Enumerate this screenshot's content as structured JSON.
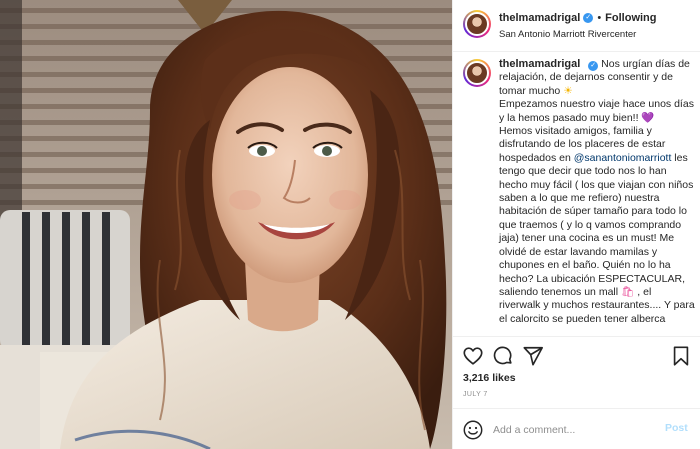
{
  "post": {
    "author": {
      "username": "thelmamadrigal",
      "verified": true,
      "follow_state": "Following",
      "location": "San Antonio Marriott Rivercenter"
    },
    "caption": {
      "p1": "Nos urgían días de relajación, de dejarnos consentir y de tomar mucho",
      "emoji_sun": "☀",
      "p2": "Empezamos nuestro viaje hace unos días y la hemos pasado muy bien!!",
      "emoji_heart": "💜",
      "p3": "Hemos visitado amigos, familia y disfrutando de los placeres de estar hospedados en",
      "mention": "@sanantoniomarriott",
      "p4": "les tengo que decir que todo nos lo han hecho muy fácil ( los que viajan con niños saben a lo que me refiero) nuestra habitación de súper tamaño para todo lo que traemos ( y lo q vamos comprando jaja) tener una cocina es un must! Me olvidé de estar lavando mamilas y chupones en el baño. Quién no lo ha hecho? La ubicación ESPECTACULAR, saliendo tenemos un mall",
      "emoji_bag": "🛍",
      "p5": ", el riverwalk y muchos restaurantes.... Y para el calorcito se",
      "p6": "pueden tener alberca"
    },
    "likes": "3,216 likes",
    "date": "JULY 7"
  },
  "icons": {
    "like": "heart-outline-icon",
    "comment": "speech-bubble-icon",
    "share": "paper-plane-icon",
    "save": "bookmark-icon",
    "emoji": "smile-face-icon",
    "verified": "verified-badge-icon"
  },
  "comment_box": {
    "placeholder": "Add a comment...",
    "post_label": "Post"
  },
  "colors": {
    "verified": "#3897f0",
    "mention": "#00376b",
    "post_disabled": "#b2dffc",
    "meta": "#8e8e8e"
  }
}
